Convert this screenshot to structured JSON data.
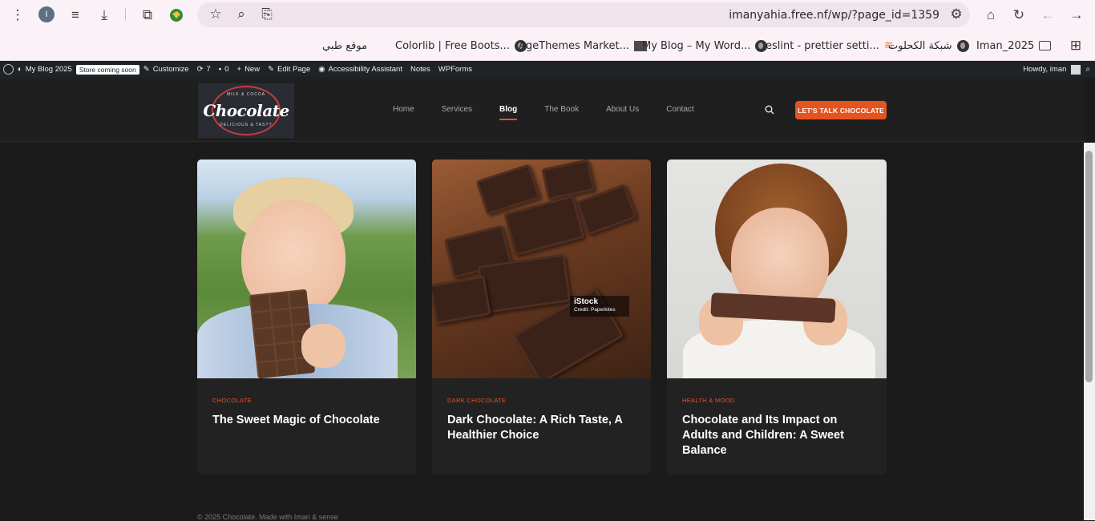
{
  "browser": {
    "url": "imanyahia.free.nf/wp/?page_id=1359",
    "profile_initial": "I",
    "bookmarks": [
      {
        "label": "موقع طبي"
      },
      {
        "label": "Colorlib | Free Boots..."
      },
      {
        "label": "AgeThemes Market..."
      },
      {
        "label": "My Blog – My Word..."
      },
      {
        "label": "eslint - prettier setti..."
      },
      {
        "label": "شبكة الكحلوت"
      },
      {
        "label": "Iman_2025"
      }
    ]
  },
  "adminbar": {
    "site_name": "My Blog 2025",
    "store_badge": "Store coming soon",
    "customize": "Customize",
    "updates": "7",
    "comments": "0",
    "new": "New",
    "edit_page": "Edit Page",
    "accessibility": "Accessibility Assistant",
    "notes": "Notes",
    "wpforms": "WPForms",
    "howdy": "Howdy, iman"
  },
  "header": {
    "logo_text": "Chocolate",
    "logo_top": "MILK & COCOA",
    "logo_bottom": "DELICIOUS & TASTY",
    "nav": [
      "Home",
      "Services",
      "Blog",
      "The Book",
      "About Us",
      "Contact"
    ],
    "active_nav": "Blog",
    "cta": "LET'S TALK CHOCOLATE"
  },
  "posts": [
    {
      "category": "CHOCOLATE",
      "title": "The Sweet Magic of Chocolate"
    },
    {
      "category": "DARK CHOCOLATE",
      "title": "Dark Chocolate: A Rich Taste, A Healthier Choice",
      "image_credit_brand": "iStock",
      "image_credit": "Credit: Paperkites"
    },
    {
      "category": "HEALTH & MOOD",
      "title": "Chocolate and Its Impact on Adults and Children: A Sweet Balance"
    }
  ],
  "footer": {
    "text": "© 2025 Chocolate. Made with Iman & sense"
  },
  "colors": {
    "accent": "#e5532a",
    "background": "#1b1b1b",
    "card": "#222222"
  }
}
